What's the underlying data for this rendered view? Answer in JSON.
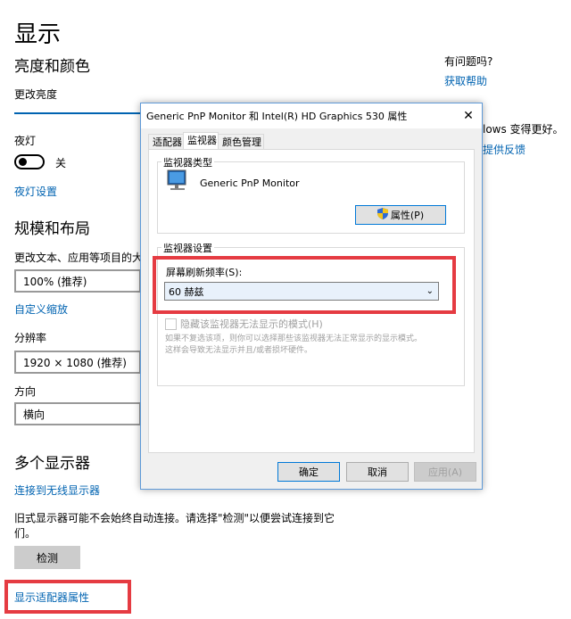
{
  "settings": {
    "page_title": "显示",
    "brightness_section": "亮度和颜色",
    "change_brightness": "更改亮度",
    "night_light_label": "夜灯",
    "night_light_state": "关",
    "night_light_settings": "夜灯设置",
    "scale_section": "规模和布局",
    "scale_label": "更改文本、应用等项目的大",
    "scale_value": "100% (推荐)",
    "custom_scaling": "自定义缩放",
    "resolution_label": "分辨率",
    "resolution_value": "1920 × 1080 (推荐)",
    "orientation_label": "方向",
    "orientation_value": "横向",
    "multi_display_section": "多个显示器",
    "connect_wireless": "连接到无线显示器",
    "old_display_note": "旧式显示器可能不会始终自动连接。请选择\"检测\"以便尝试连接到它们。",
    "detect_button": "检测",
    "adapter_properties": "显示适配器属性"
  },
  "help": {
    "question": "有问题吗?",
    "get_help": "获取帮助",
    "better_text": "lows 变得更好。",
    "feedback": "提供反馈"
  },
  "dialog": {
    "title": "Generic PnP Monitor 和 Intel(R) HD Graphics 530 属性",
    "close": "✕",
    "tabs": [
      "适配器",
      "监视器",
      "颜色管理"
    ],
    "monitor_type_group": "监视器类型",
    "monitor_name": "Generic PnP Monitor",
    "properties_button": "属性(P)",
    "monitor_settings_group": "监视器设置",
    "refresh_label": "屏幕刷新频率(S):",
    "refresh_value": "60 赫兹",
    "hide_modes_label": "隐藏该监视器无法显示的模式(H)",
    "hide_modes_desc_1": "如果不复选该项，则你可以选择那些该监视器无法正常显示的显示模式。",
    "hide_modes_desc_2": "这样会导致无法显示并且/或者损坏硬件。",
    "ok": "确定",
    "cancel": "取消",
    "apply": "应用(A)"
  },
  "colors": {
    "accent": "#0063b1",
    "highlight": "#e53b42"
  }
}
